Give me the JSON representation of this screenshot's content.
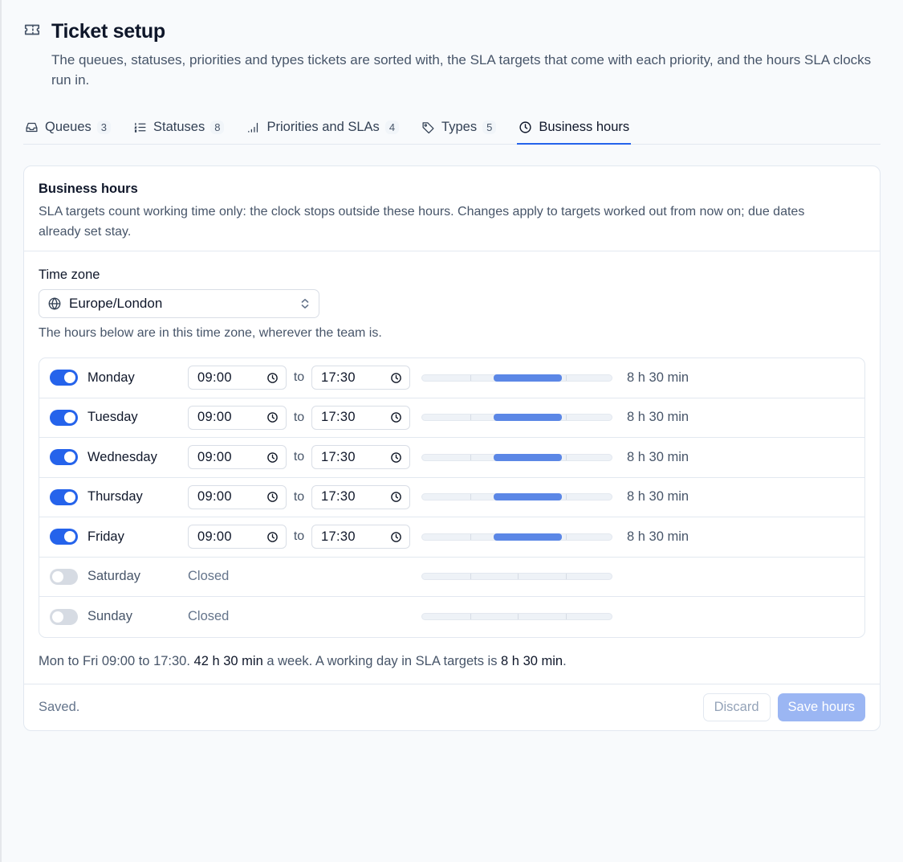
{
  "page": {
    "title": "Ticket setup",
    "description": "The queues, statuses, priorities and types tickets are sorted with, the SLA targets that come with each priority, and the hours SLA clocks run in."
  },
  "tabs": [
    {
      "label": "Queues",
      "count": "3",
      "icon": "inbox-icon",
      "active": false
    },
    {
      "label": "Statuses",
      "count": "8",
      "icon": "list-icon",
      "active": false
    },
    {
      "label": "Priorities and SLAs",
      "count": "4",
      "icon": "signal-icon",
      "active": false
    },
    {
      "label": "Types",
      "count": "5",
      "icon": "tag-icon",
      "active": false
    },
    {
      "label": "Business hours",
      "count": "",
      "icon": "clock-icon",
      "active": true
    }
  ],
  "card": {
    "title": "Business hours",
    "subtitle": "SLA targets count working time only: the clock stops outside these hours. Changes apply to targets worked out from now on; due dates already set stay.",
    "timezone_label": "Time zone",
    "timezone_value": "Europe/London",
    "timezone_hint": "The hours below are in this time zone, wherever the team is.",
    "to_label": "to",
    "closed_label": "Closed",
    "days": [
      {
        "name": "Monday",
        "enabled": true,
        "start": "09:00",
        "end": "17:30",
        "duration": "8 h 30 min"
      },
      {
        "name": "Tuesday",
        "enabled": true,
        "start": "09:00",
        "end": "17:30",
        "duration": "8 h 30 min"
      },
      {
        "name": "Wednesday",
        "enabled": true,
        "start": "09:00",
        "end": "17:30",
        "duration": "8 h 30 min"
      },
      {
        "name": "Thursday",
        "enabled": true,
        "start": "09:00",
        "end": "17:30",
        "duration": "8 h 30 min"
      },
      {
        "name": "Friday",
        "enabled": true,
        "start": "09:00",
        "end": "17:30",
        "duration": "8 h 30 min"
      },
      {
        "name": "Saturday",
        "enabled": false,
        "start": "",
        "end": "",
        "duration": ""
      },
      {
        "name": "Sunday",
        "enabled": false,
        "start": "",
        "end": "",
        "duration": ""
      }
    ],
    "summary": {
      "prefix": "Mon to Fri 09:00 to 17:30.",
      "weekly": "42 h 30 min",
      "middle": "a week. A working day in SLA targets is",
      "daily": "8 h 30 min",
      "suffix": "."
    },
    "status_text": "Saved.",
    "discard_label": "Discard",
    "save_label": "Save hours"
  },
  "colors": {
    "accent": "#2563eb",
    "bar_fill": "#5b87e6",
    "save_disabled": "#9bb6f3"
  }
}
